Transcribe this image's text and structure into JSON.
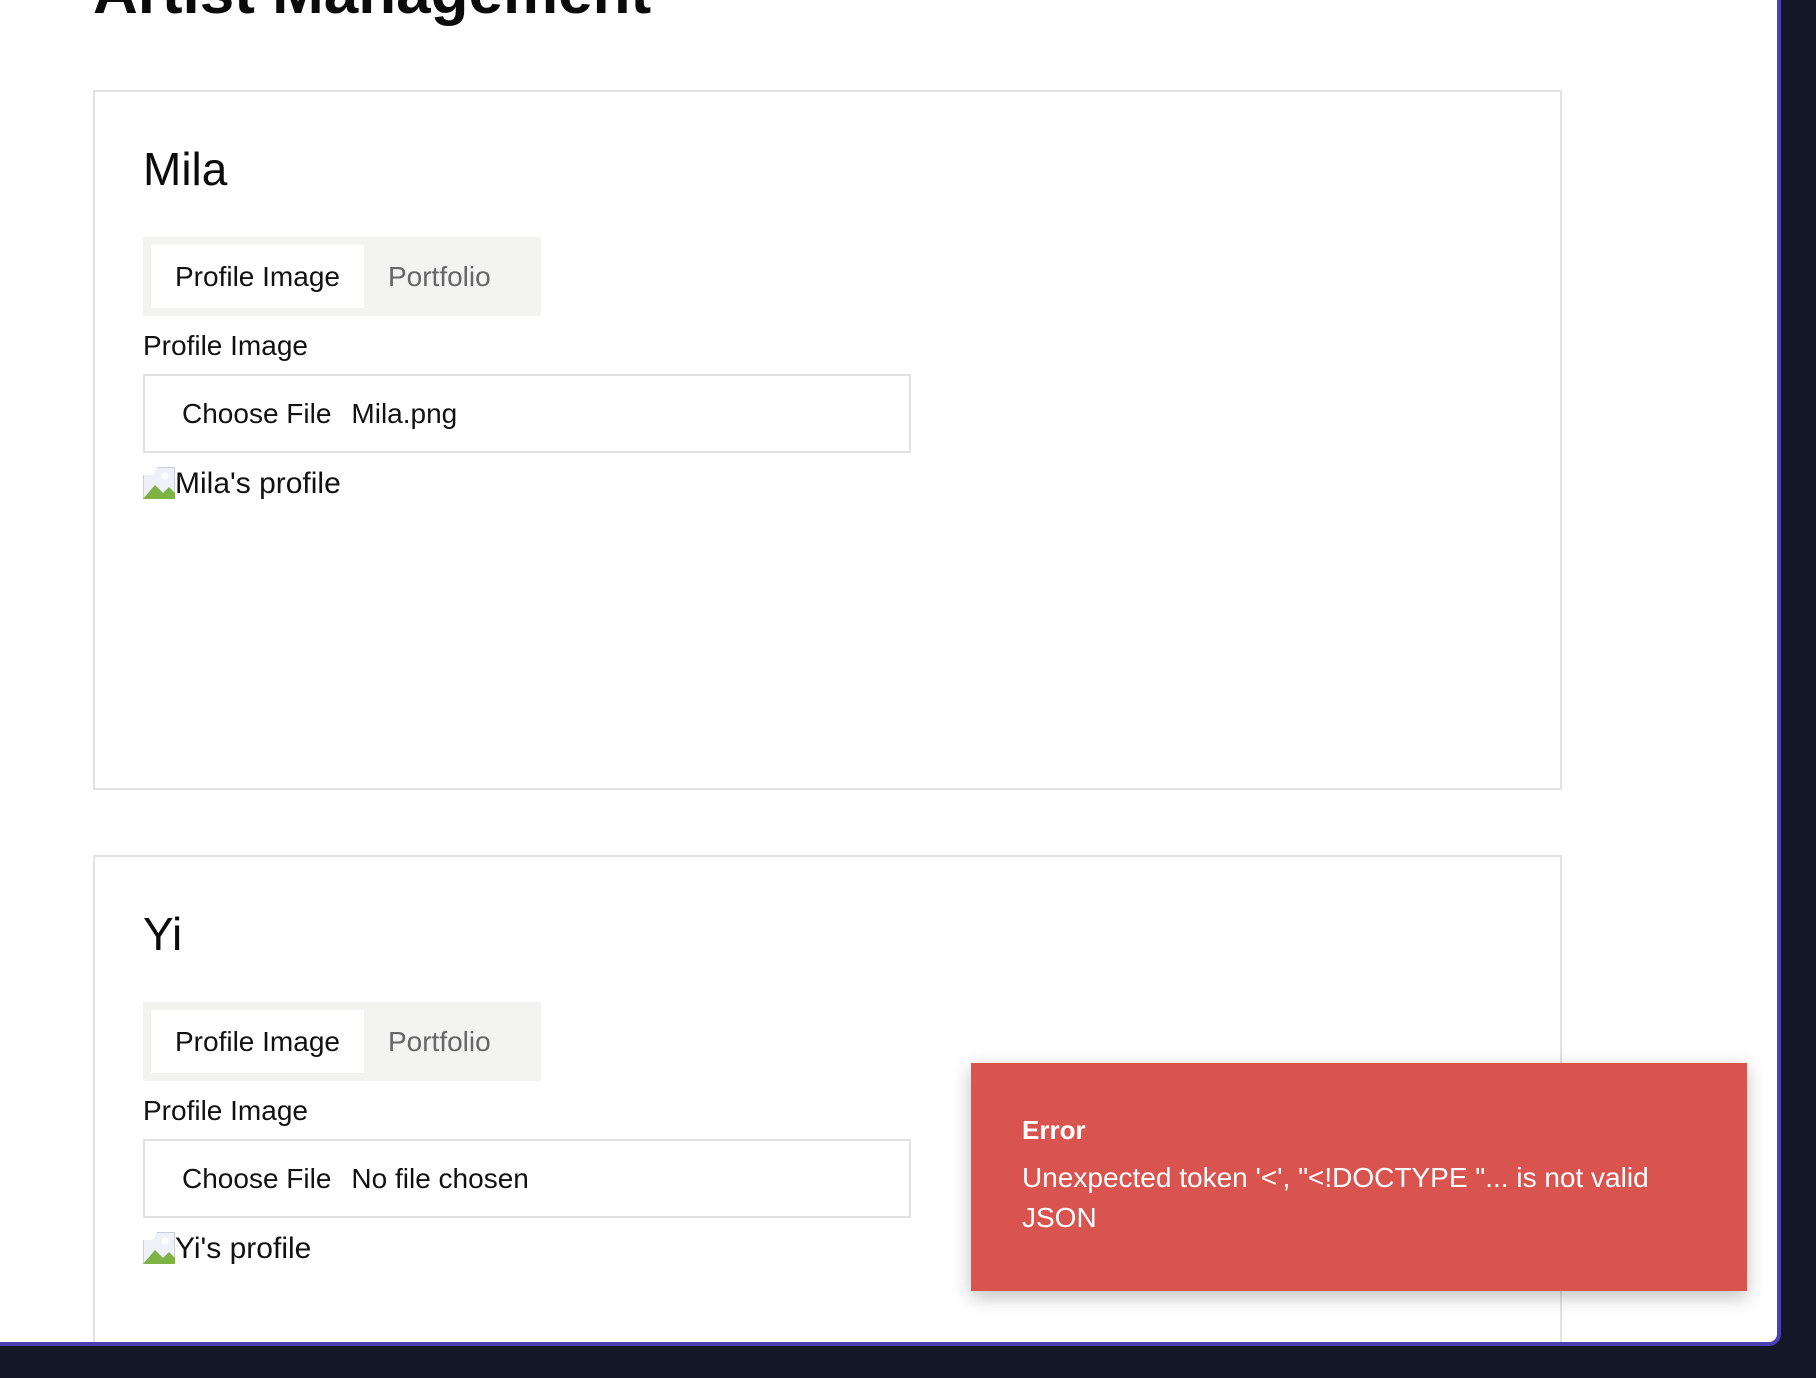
{
  "page": {
    "title": "Artist Management"
  },
  "artists": [
    {
      "name": "Mila",
      "tabs": [
        "Profile Image",
        "Portfolio"
      ],
      "active_tab": "Profile Image",
      "field_label": "Profile Image",
      "choose_file_label": "Choose File",
      "file_name": "Mila.png",
      "image_alt": "Mila's profile"
    },
    {
      "name": "Yi",
      "tabs": [
        "Profile Image",
        "Portfolio"
      ],
      "active_tab": "Profile Image",
      "field_label": "Profile Image",
      "choose_file_label": "Choose File",
      "file_name": "No file chosen",
      "image_alt": "Yi's profile"
    }
  ],
  "toast": {
    "title": "Error",
    "message": "Unexpected token '<', \"<!DOCTYPE \"... is not valid JSON",
    "color": "#d9534f"
  },
  "colors": {
    "window_border": "#4b3fb4",
    "background": "#141826"
  }
}
